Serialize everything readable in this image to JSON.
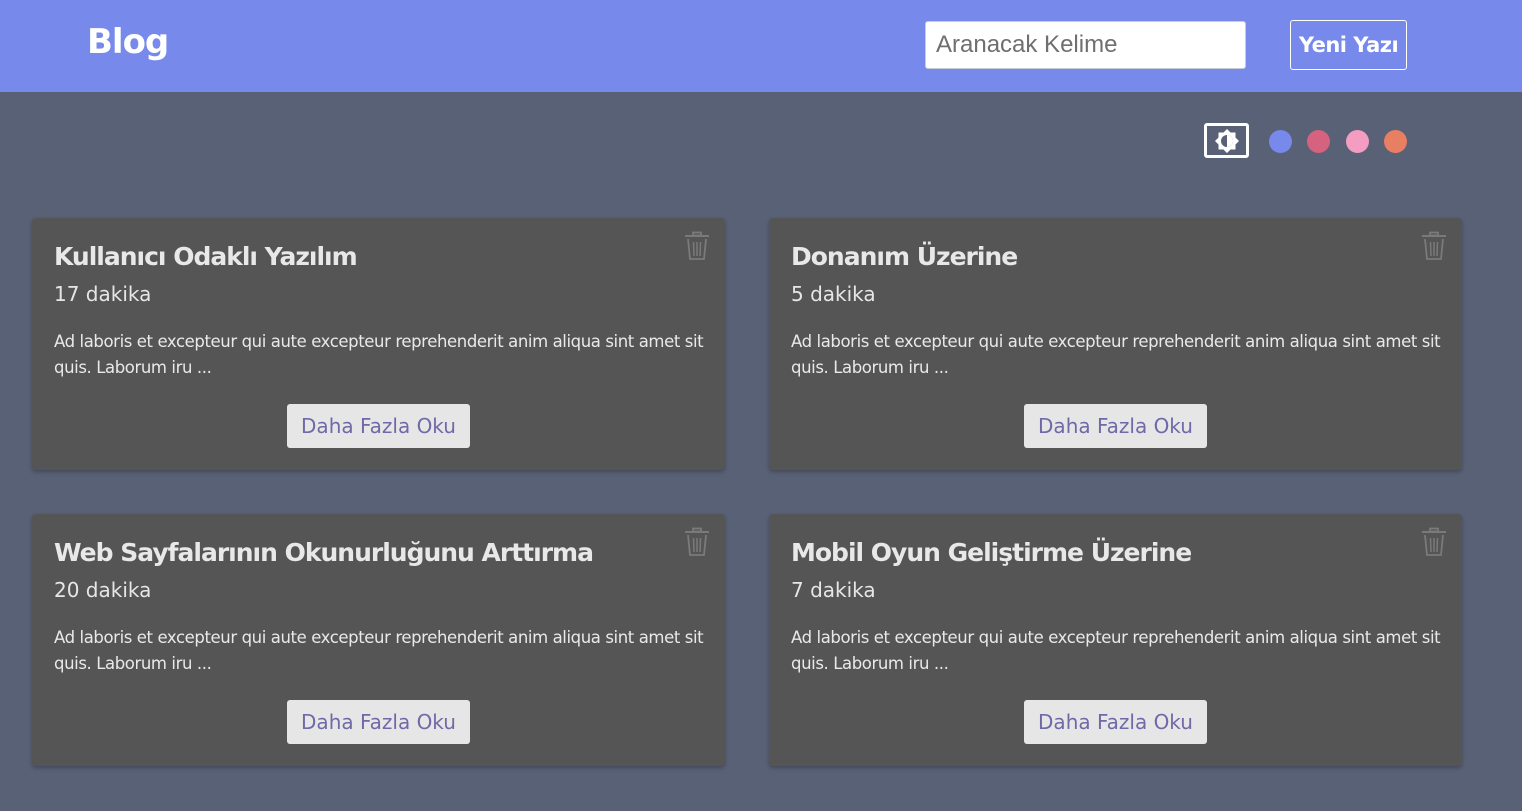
{
  "header": {
    "brand": "Blog",
    "search_placeholder": "Aranacak Kelime",
    "new_post_label": "Yeni Yazı"
  },
  "theme": {
    "toggle_icon": "brightness-icon",
    "swatches": [
      {
        "name": "blue",
        "color": "#7789ea"
      },
      {
        "name": "rose",
        "color": "#d5637f"
      },
      {
        "name": "pink",
        "color": "#f49cc1"
      },
      {
        "name": "orange",
        "color": "#e97f62"
      }
    ]
  },
  "posts": [
    {
      "title": "Kullanıcı Odaklı Yazılım",
      "read_time": "17 dakika",
      "excerpt": "Ad laboris et excepteur qui aute excepteur reprehenderit anim aliqua sint amet sit quis. Laborum iru ...",
      "button": "Daha Fazla Oku"
    },
    {
      "title": "Donanım Üzerine",
      "read_time": "5 dakika",
      "excerpt": "Ad laboris et excepteur qui aute excepteur reprehenderit anim aliqua sint amet sit quis. Laborum iru ...",
      "button": "Daha Fazla Oku"
    },
    {
      "title": "Web Sayfalarının Okunurluğunu Arttırma",
      "read_time": "20 dakika",
      "excerpt": "Ad laboris et excepteur qui aute excepteur reprehenderit anim aliqua sint amet sit quis. Laborum iru ...",
      "button": "Daha Fazla Oku"
    },
    {
      "title": "Mobil Oyun Geliştirme Üzerine",
      "read_time": "7 dakika",
      "excerpt": "Ad laboris et excepteur qui aute excepteur reprehenderit anim aliqua sint amet sit quis. Laborum iru ...",
      "button": "Daha Fazla Oku"
    }
  ]
}
